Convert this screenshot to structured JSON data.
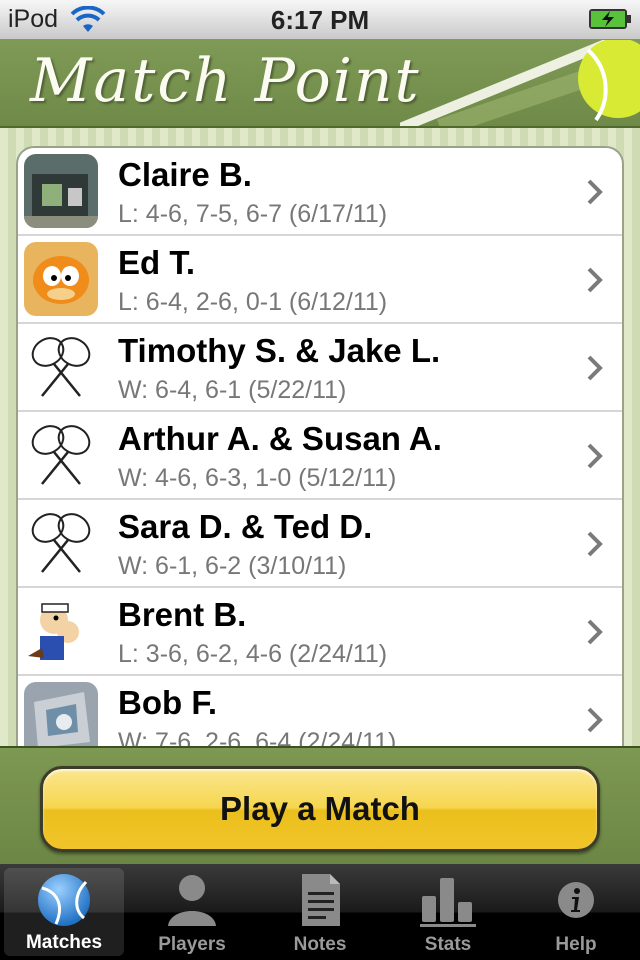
{
  "status_bar": {
    "carrier": "iPod",
    "time": "6:17 PM"
  },
  "header": {
    "title": "Match Point"
  },
  "matches": [
    {
      "name": "Claire B.",
      "score": "L: 4-6, 7-5, 6-7 (6/17/11)",
      "avatar": "photo"
    },
    {
      "name": "Ed T.",
      "score": "L: 6-4, 2-6, 0-1 (6/12/11)",
      "avatar": "cartoon-cat"
    },
    {
      "name": "Timothy S. & Jake L.",
      "score": "W: 6-4, 6-1 (5/22/11)",
      "avatar": "rackets-icon"
    },
    {
      "name": "Arthur A. & Susan A.",
      "score": "W: 4-6, 6-3, 1-0 (5/12/11)",
      "avatar": "rackets-icon"
    },
    {
      "name": "Sara D. & Ted D.",
      "score": "W: 6-1, 6-2 (3/10/11)",
      "avatar": "rackets-icon"
    },
    {
      "name": "Brent B.",
      "score": "L: 3-6, 6-2, 4-6 (2/24/11)",
      "avatar": "cartoon-sailor"
    },
    {
      "name": "Bob F.",
      "score": "W: 7-6, 2-6, 6-4 (2/24/11)",
      "avatar": "photo"
    }
  ],
  "play_button": {
    "label": "Play a Match"
  },
  "tabs": [
    {
      "label": "Matches",
      "icon": "tennis-ball-icon",
      "active": true
    },
    {
      "label": "Players",
      "icon": "person-icon",
      "active": false
    },
    {
      "label": "Notes",
      "icon": "document-icon",
      "active": false
    },
    {
      "label": "Stats",
      "icon": "bar-chart-icon",
      "active": false
    },
    {
      "label": "Help",
      "icon": "info-icon",
      "active": false
    }
  ],
  "colors": {
    "header_green": "#7a9550",
    "button_yellow": "#f3cf3c",
    "tab_blue": "#3a8fd6"
  }
}
